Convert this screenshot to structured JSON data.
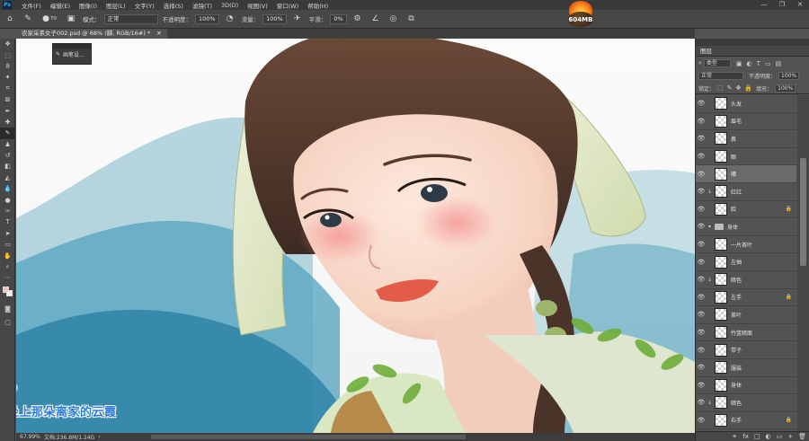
{
  "app": {
    "logo_text": "Ps"
  },
  "menu": [
    "文件(F)",
    "编辑(E)",
    "图像(I)",
    "图层(L)",
    "文字(Y)",
    "选择(S)",
    "滤镜(T)",
    "3D(D)",
    "视图(V)",
    "窗口(W)",
    "帮助(H)"
  ],
  "window_controls": [
    "—",
    "❐",
    "✕"
  ],
  "options": {
    "brush_size": "70",
    "mode_label": "模式：",
    "mode_value": "正常",
    "opacity_label": "不透明度：",
    "opacity_value": "100%",
    "flow_label": "流量：",
    "flow_value": "100%",
    "smooth_label": "平滑：",
    "smooth_value": "0%"
  },
  "badge": {
    "text": "604MB"
  },
  "document_tab": {
    "title": "农家采茶女子002.psd @ 68% (脚, RGB/16#) *",
    "close": "✕"
  },
  "brush_popup": {
    "label": "画笔设..."
  },
  "watermark": "坐上那朵离家的云霞",
  "status": {
    "zoom": "67.99%",
    "doc": "文档:236.8M/1.24G",
    "arrow": "›"
  },
  "panel": {
    "title": "图层",
    "filter_label": "类型",
    "blend_mode": "正常",
    "opacity_label": "不透明度：",
    "opacity_value": "100%",
    "lock_label": "锁定：",
    "fill_label": "填充：",
    "fill_value": "100%",
    "footer_icons": [
      "fx",
      "□",
      "◐",
      "▭",
      "+",
      "🗑"
    ]
  },
  "layers": [
    {
      "name": "头发",
      "clipped": false,
      "locked": false,
      "selected": false,
      "group": false
    },
    {
      "name": "眉毛",
      "clipped": false,
      "locked": false,
      "selected": false,
      "group": false
    },
    {
      "name": "鼻",
      "clipped": false,
      "locked": false,
      "selected": false,
      "group": false
    },
    {
      "name": "眼",
      "clipped": false,
      "locked": false,
      "selected": false,
      "group": false
    },
    {
      "name": "嘴",
      "clipped": false,
      "locked": false,
      "selected": true,
      "group": false
    },
    {
      "name": "红红",
      "clipped": true,
      "locked": false,
      "selected": false,
      "group": false
    },
    {
      "name": "脸",
      "clipped": false,
      "locked": true,
      "selected": false,
      "group": false
    },
    {
      "name": "身体",
      "clipped": false,
      "locked": false,
      "selected": false,
      "group": true
    },
    {
      "name": "一片茶叶",
      "clipped": false,
      "locked": false,
      "selected": false,
      "group": false
    },
    {
      "name": "左抽",
      "clipped": false,
      "locked": false,
      "selected": false,
      "group": false
    },
    {
      "name": "暗色",
      "clipped": true,
      "locked": false,
      "selected": false,
      "group": false
    },
    {
      "name": "左手",
      "clipped": false,
      "locked": true,
      "selected": false,
      "group": false
    },
    {
      "name": "茶叶",
      "clipped": false,
      "locked": false,
      "selected": false,
      "group": false
    },
    {
      "name": "竹篮暗面",
      "clipped": false,
      "locked": false,
      "selected": false,
      "group": false
    },
    {
      "name": "带子",
      "clipped": false,
      "locked": false,
      "selected": false,
      "group": false
    },
    {
      "name": "服装",
      "clipped": false,
      "locked": false,
      "selected": false,
      "group": false
    },
    {
      "name": "身体",
      "clipped": false,
      "locked": false,
      "selected": false,
      "group": false
    },
    {
      "name": "暗色",
      "clipped": true,
      "locked": false,
      "selected": false,
      "group": false
    },
    {
      "name": "右手",
      "clipped": false,
      "locked": true,
      "selected": false,
      "group": false
    }
  ],
  "colors": {
    "foreground": "#e9c3b8",
    "background": "#f6ece6",
    "accent": "#31a8ff",
    "watermark": "#2f7bd8"
  }
}
